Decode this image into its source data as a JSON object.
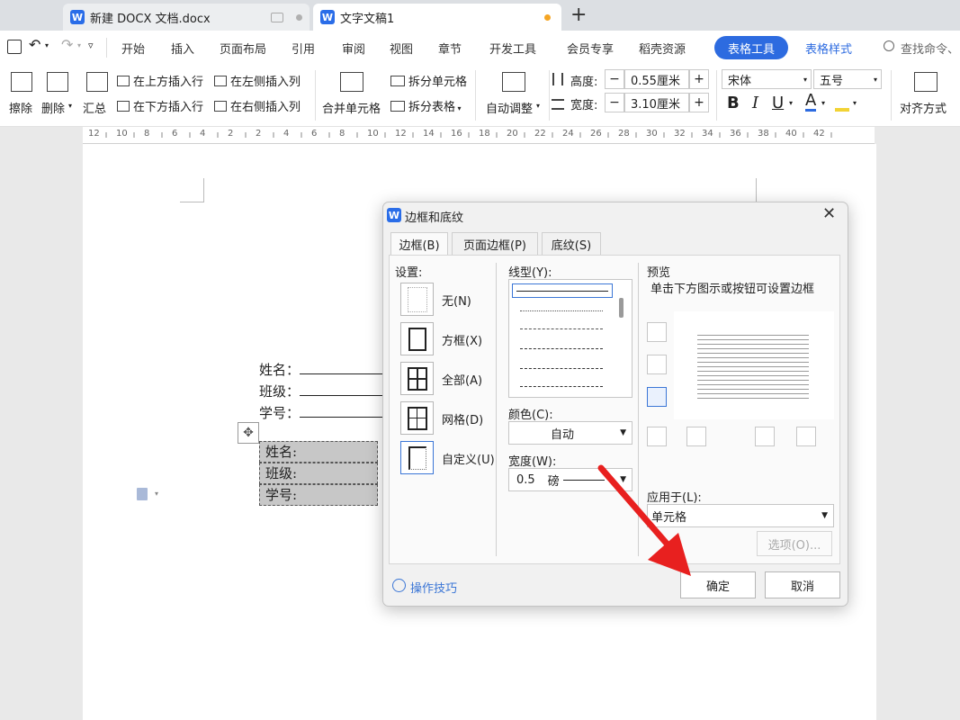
{
  "tabs": [
    {
      "title": "新建 DOCX 文档.docx"
    },
    {
      "title": "文字文稿1"
    }
  ],
  "menu": {
    "items": [
      "开始",
      "插入",
      "页面布局",
      "引用",
      "审阅",
      "视图",
      "章节",
      "开发工具",
      "会员专享",
      "稻壳资源"
    ],
    "active": "表格工具",
    "table_style": "表格样式",
    "search": "查找命令、"
  },
  "ribbon": {
    "erase": "擦除",
    "delete": "删除",
    "summary": "汇总",
    "insert_above": "在上方插入行",
    "insert_below": "在下方插入行",
    "insert_left": "在左侧插入列",
    "insert_right": "在右侧插入列",
    "merge": "合并单元格",
    "split_cell": "拆分单元格",
    "split_table": "拆分表格",
    "auto_adjust": "自动调整",
    "height_label": "高度:",
    "height_value": "0.55厘米",
    "width_label": "宽度:",
    "width_value": "3.10厘米",
    "font": "宋体",
    "size": "五号",
    "align": "对齐方式",
    "bold": "B",
    "italic": "I",
    "underline": "U",
    "fontcolor": "A",
    "minus": "−",
    "plus": "+"
  },
  "ruler": [
    "12",
    "10",
    "8",
    "6",
    "4",
    "2",
    "2",
    "4",
    "6",
    "8",
    "10",
    "12",
    "14",
    "16",
    "18",
    "20",
    "22",
    "24",
    "26",
    "28",
    "30",
    "32",
    "34",
    "36",
    "38",
    "40",
    "42"
  ],
  "document": {
    "lines": [
      "姓名：",
      "班级：",
      "学号："
    ],
    "table": [
      "姓名:",
      "班级:",
      "学号:"
    ]
  },
  "dialog": {
    "title": "边框和底纹",
    "tabs": [
      "边框(B)",
      "页面边框(P)",
      "底纹(S)"
    ],
    "settings_label": "设置:",
    "settings": [
      "无(N)",
      "方框(X)",
      "全部(A)",
      "网格(D)",
      "自定义(U)"
    ],
    "line_style_label": "线型(Y):",
    "color_label": "颜色(C):",
    "color_value": "自动",
    "width_label": "宽度(W):",
    "width_value": "0.5",
    "width_unit": "磅",
    "preview_label": "预览",
    "preview_hint": "单击下方图示或按钮可设置边框",
    "apply_label": "应用于(L):",
    "apply_value": "单元格",
    "options_button": "选项(O)...",
    "tips": "操作技巧",
    "ok": "确定",
    "cancel": "取消"
  },
  "colors": {
    "accent": "#2d6be0",
    "arrow": "#e8201f",
    "tab_dot": "#f5a524"
  }
}
